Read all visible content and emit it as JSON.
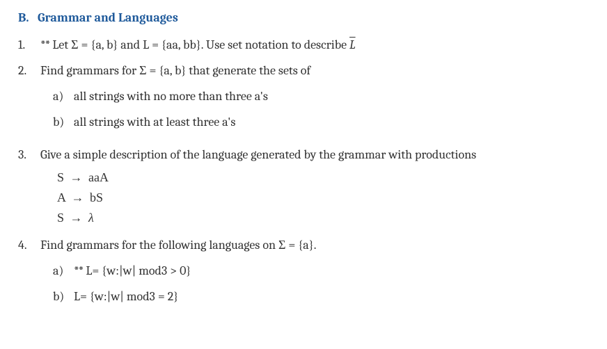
{
  "section": {
    "letter": "B.",
    "title": "Grammar and Languages"
  },
  "questions": [
    {
      "number": "1.",
      "stars": "**",
      "text_parts": {
        "p1": "Let Σ = {a, b} and L = {aa, bb}. Use set notation to describe ",
        "symbol": "L̄"
      }
    },
    {
      "number": "2.",
      "text": "Find grammars for Σ = {a, b} that generate the sets of",
      "subitems": [
        {
          "letter": "a)",
          "text": "all strings with no more than three a's"
        },
        {
          "letter": "b)",
          "text": "all strings with at least three a's"
        }
      ]
    },
    {
      "number": "3.",
      "text": "Give a simple description of the language generated by the grammar with productions",
      "productions": [
        {
          "lhs": "S",
          "rhs": "aaA"
        },
        {
          "lhs": "A",
          "rhs": "bS"
        },
        {
          "lhs": "S",
          "rhs": "λ",
          "rhs_italic": true
        }
      ]
    },
    {
      "number": "4.",
      "text": "Find grammars for the following languages on Σ = {a}.",
      "subitems": [
        {
          "letter": "a)",
          "stars": "**",
          "text": "L= {w:|w| mod3 > 0}"
        },
        {
          "letter": "b)",
          "text": "L= {w:|w| mod3 = 2}"
        }
      ]
    }
  ],
  "chart_data": {
    "type": "table",
    "title": "B. Grammar and Languages — problem set",
    "rows": [
      {
        "id": "1",
        "marked": true,
        "prompt": "Let Σ = {a, b} and L = {aa, bb}. Use set notation to describe the complement of L (L̄)."
      },
      {
        "id": "2",
        "prompt": "Find grammars for Σ = {a, b} that generate the sets of:",
        "parts": [
          {
            "id": "2a",
            "prompt": "all strings with no more than three a's"
          },
          {
            "id": "2b",
            "prompt": "all strings with at least three a's"
          }
        ]
      },
      {
        "id": "3",
        "prompt": "Give a simple description of the language generated by the grammar with productions",
        "productions": [
          "S → aaA",
          "A → bS",
          "S → λ"
        ]
      },
      {
        "id": "4",
        "prompt": "Find grammars for the following languages on Σ = {a}.",
        "parts": [
          {
            "id": "4a",
            "marked": true,
            "prompt": "L = {w : |w| mod 3 > 0}"
          },
          {
            "id": "4b",
            "prompt": "L = {w : |w| mod 3 = 2}"
          }
        ]
      }
    ]
  }
}
